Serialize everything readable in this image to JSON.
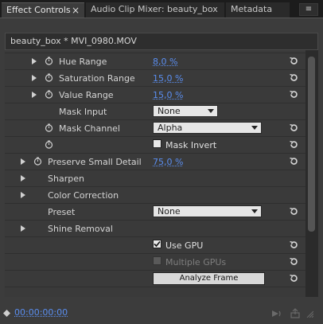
{
  "tabs": [
    {
      "label": "Effect Controls",
      "active": true,
      "close": "×"
    },
    {
      "label": "Audio Clip Mixer: beauty_box",
      "active": false
    },
    {
      "label": "Metadata",
      "active": false
    }
  ],
  "panel_menu_icon": "≡",
  "clip_header": "beauty_box * MVI_0980.MOV",
  "rows": {
    "hue_range": {
      "label": "Hue Range",
      "value": "8,0 %"
    },
    "saturation_range": {
      "label": "Saturation Range",
      "value": "15,0 %"
    },
    "value_range": {
      "label": "Value Range",
      "value": "15,0 %"
    },
    "mask_input": {
      "label": "Mask Input",
      "selected": "None"
    },
    "mask_channel": {
      "label": "Mask Channel",
      "selected": "Alpha"
    },
    "mask_invert": {
      "label": "Mask Invert",
      "checked": false
    },
    "preserve_small_detail": {
      "label": "Preserve Small Detail",
      "value": "75,0 %"
    },
    "sharpen": {
      "label": "Sharpen"
    },
    "color_correction": {
      "label": "Color Correction"
    },
    "preset": {
      "label": "Preset",
      "selected": "None"
    },
    "shine_removal": {
      "label": "Shine Removal"
    },
    "use_gpu": {
      "label": "Use GPU",
      "checked": true
    },
    "multiple_gpus": {
      "label": "Multiple GPUs",
      "checked": false,
      "disabled": true
    },
    "analyze_frame": {
      "label": "Analyze Frame"
    }
  },
  "footer": {
    "timecode": "00:00:00:00"
  },
  "colors": {
    "accent": "#5a8ef0",
    "panel_bg": "#3c3c3c"
  }
}
